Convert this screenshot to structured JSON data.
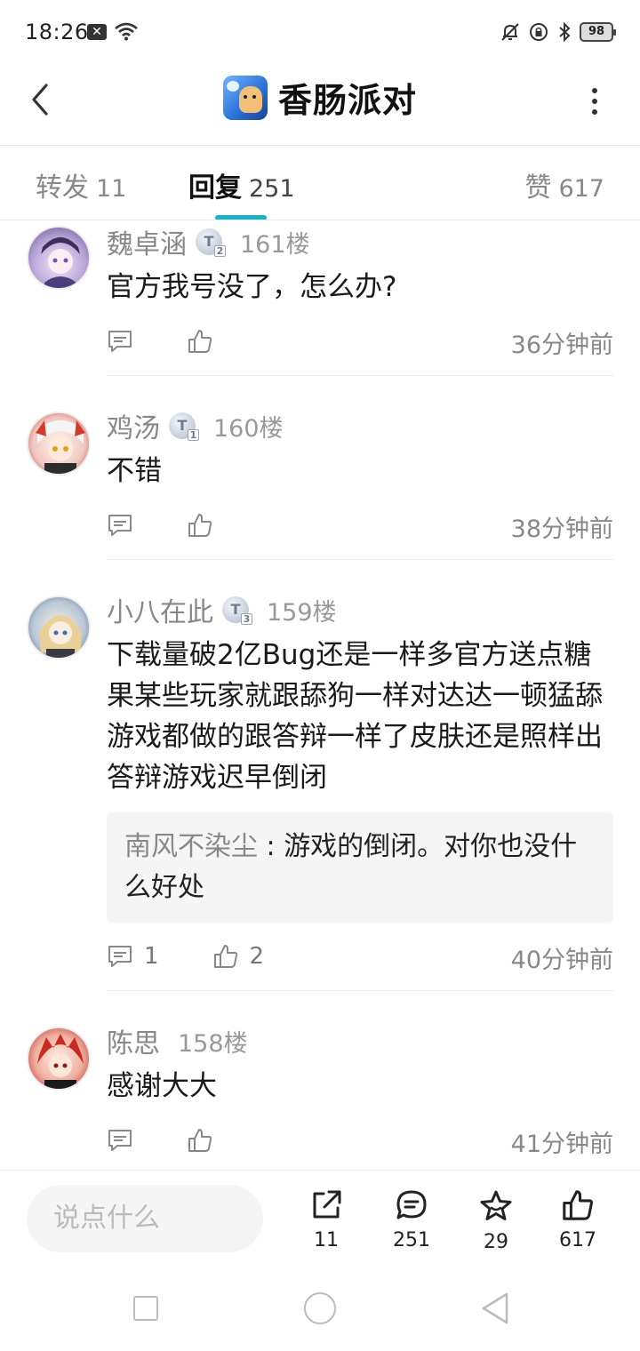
{
  "status_bar": {
    "time": "18:26",
    "battery": "98"
  },
  "header": {
    "title": "香肠派对"
  },
  "tabs": [
    {
      "label": "转发",
      "count": "11"
    },
    {
      "label": "回复",
      "count": "251"
    },
    {
      "label": "赞",
      "count": "617"
    }
  ],
  "replies": [
    {
      "user": "魏卓涵",
      "badge_level": "2",
      "floor": "161楼",
      "text": "官方我号没了，怎么办?",
      "time": "36分钟前"
    },
    {
      "user": "鸡汤",
      "badge_level": "1",
      "floor": "160楼",
      "text": "不错",
      "time": "38分钟前"
    },
    {
      "user": "小八在此",
      "badge_level": "3",
      "floor": "159楼",
      "text": "下载量破2亿Bug还是一样多官方送点糖果某些玩家就跟舔狗一样对达达一顿猛舔游戏都做的跟答辩一样了皮肤还是照样出答辩游戏迟早倒闭",
      "quote_user": "南风不染尘",
      "quote_sep": " : ",
      "quote_text": "游戏的倒闭。对你也没什么好处",
      "comment_count": "1",
      "like_count": "2",
      "time": "40分钟前"
    },
    {
      "user": "陈思",
      "floor": "158楼",
      "text": "感谢大大",
      "time": "41分钟前"
    }
  ],
  "bottom_bar": {
    "input_placeholder": "说点什么",
    "share_count": "11",
    "comment_count": "251",
    "favorite_count": "29",
    "like_count": "617"
  },
  "colors": {
    "accent": "#18b4c6",
    "muted_text": "#888888",
    "quote_bg": "#f5f5f5"
  }
}
